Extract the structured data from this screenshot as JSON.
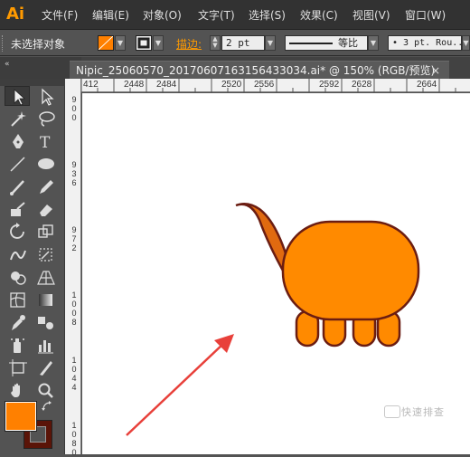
{
  "app": {
    "logo": "Ai",
    "accent": "#ff9a00"
  },
  "menu": {
    "items": [
      "文件(F)",
      "编辑(E)",
      "对象(O)",
      "文字(T)",
      "选择(S)",
      "效果(C)",
      "视图(V)",
      "窗口(W)"
    ]
  },
  "control_bar": {
    "selection_status": "未选择对象",
    "fill_color": "#ff8000",
    "stroke_label": "描边:",
    "stroke_weight": "2 pt",
    "stroke_profile": "等比",
    "brush": "• 3 pt. Rou..."
  },
  "document": {
    "tab_title": "Nipic_25060570_20170607163156433034.ai* @ 150% (RGB/预览)",
    "close": "×"
  },
  "ruler": {
    "h_ticks": [
      "412",
      "2448",
      "2484",
      "2520",
      "2556",
      "2592",
      "2628",
      "2664"
    ],
    "v_ticks": [
      "900",
      "936",
      "972",
      "1008",
      "1044",
      "1080"
    ]
  },
  "artwork": {
    "body_fill": "#ff8a00",
    "tail_fill": "#e06a10",
    "outline": "#6b1d12",
    "arrow": "#e8403a"
  },
  "toolbox": {
    "fill_swatch": "#ff8000",
    "stroke_swatch": "#5a1408"
  },
  "watermark": "快速排查"
}
